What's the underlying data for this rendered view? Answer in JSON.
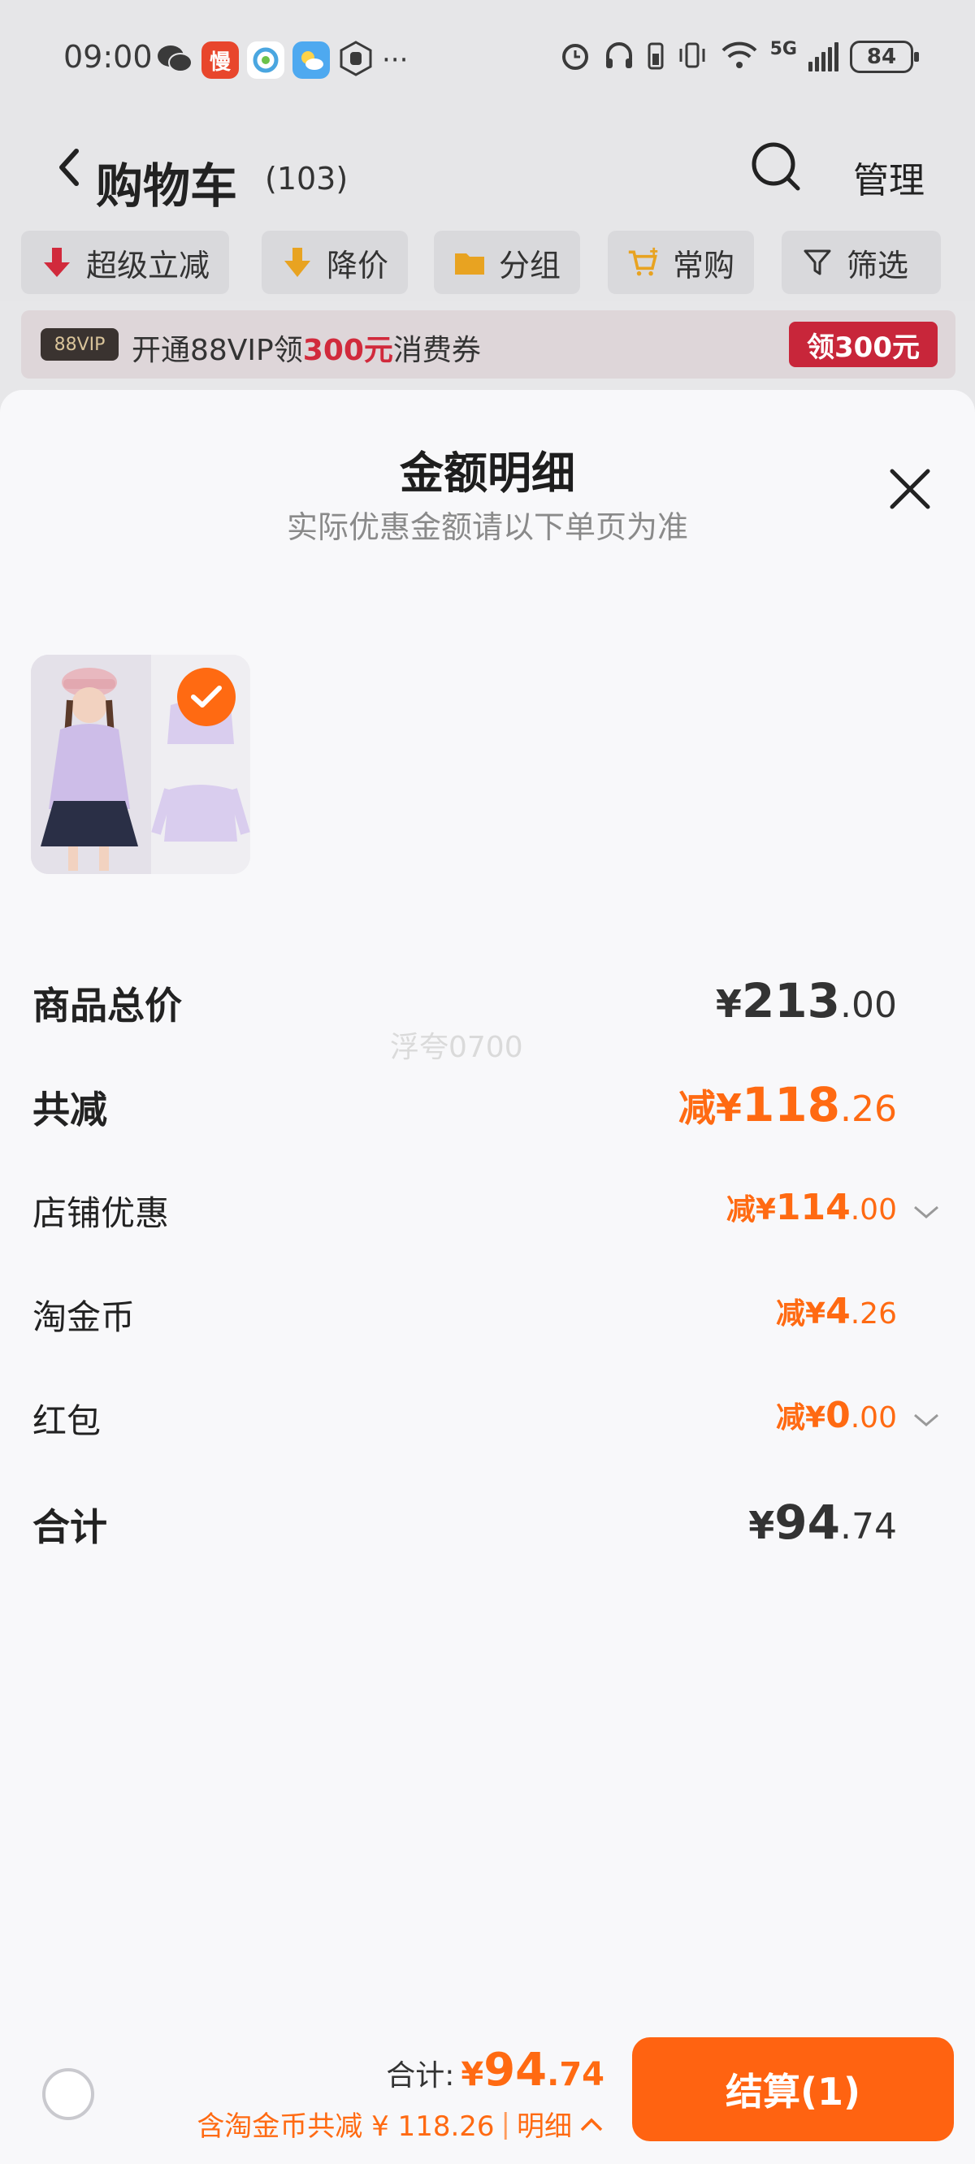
{
  "status_bar": {
    "time": "09:00",
    "apps": [
      "wechat-icon",
      "慢",
      "china-mobile-icon",
      "weather-icon",
      "hand-icon"
    ],
    "more": "···",
    "network": "5G",
    "battery": "84"
  },
  "header": {
    "title": "购物车",
    "count": "(103)",
    "manage": "管理"
  },
  "filters": [
    {
      "label": "超级立减",
      "icon": "down-arrow-icon"
    },
    {
      "label": "降价",
      "icon": "price-drop-icon"
    },
    {
      "label": "分组",
      "icon": "folder-icon"
    },
    {
      "label": "常购",
      "icon": "cart-plus-icon"
    },
    {
      "label": "筛选",
      "icon": "filter-icon"
    }
  ],
  "vip_banner": {
    "badge": "88VIP",
    "text_before": "开通88VIP领",
    "text_highlight": "300元",
    "text_after": "消费券",
    "button": "领300元"
  },
  "sheet": {
    "title": "金额明细",
    "subtitle": "实际优惠金额请以下单页为准",
    "watermark": "浮夸0700",
    "rows": {
      "goods_total": {
        "label": "商品总价",
        "currency": "¥",
        "integer": "213",
        "decimal": ".00"
      },
      "total_discount": {
        "label": "共减",
        "prefix": "减¥",
        "integer": "118",
        "decimal": ".26"
      },
      "store_discount": {
        "label": "店铺优惠",
        "prefix": "减¥",
        "integer": "114",
        "decimal": ".00"
      },
      "tao_coins": {
        "label": "淘金币",
        "prefix": "减¥",
        "integer": "4",
        "decimal": ".26"
      },
      "red_packet": {
        "label": "红包",
        "prefix": "减¥",
        "integer": "0",
        "decimal": ".00"
      },
      "sum": {
        "label": "合计",
        "currency": "¥",
        "integer": "94",
        "decimal": ".74"
      }
    }
  },
  "bottom_bar": {
    "total_label": "合计:",
    "currency": "¥",
    "integer": "94",
    "decimal": ".74",
    "saving_text": "含淘金币共减 ¥ 118.26",
    "separator": "|",
    "detail": "明细",
    "checkout": "结算(1)"
  },
  "colors": {
    "accent": "#ff6a12",
    "checkout": "#ff6311",
    "vip_red": "#c8263a"
  }
}
